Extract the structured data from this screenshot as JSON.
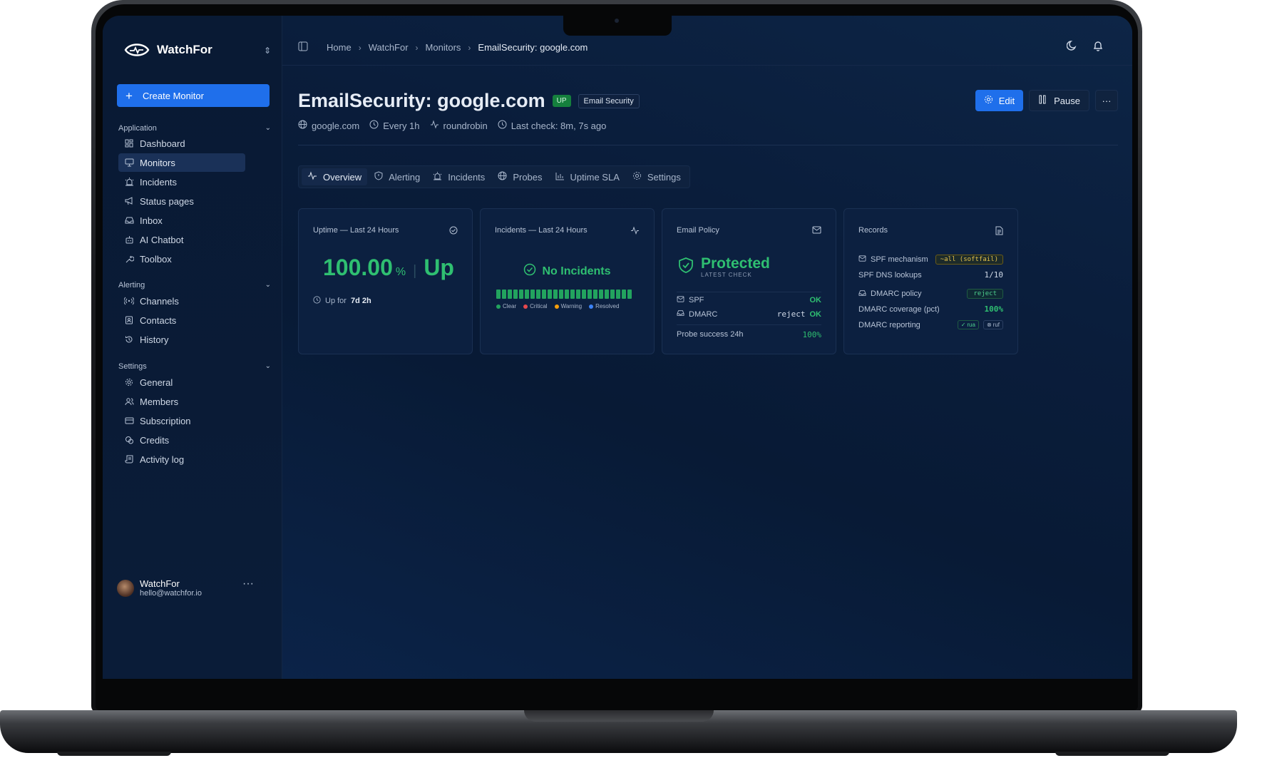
{
  "sidebar": {
    "brand": "WatchFor",
    "create_label": "Create Monitor",
    "sections": {
      "application": "Application",
      "alerting": "Alerting",
      "settings": "Settings"
    },
    "application_items": [
      "Dashboard",
      "Monitors",
      "Incidents",
      "Status pages",
      "Inbox",
      "AI Chatbot",
      "Toolbox"
    ],
    "alerting_items": [
      "Channels",
      "Contacts",
      "History"
    ],
    "settings_items": [
      "General",
      "Members",
      "Subscription",
      "Credits",
      "Activity log"
    ],
    "user": {
      "name": "WatchFor",
      "email": "hello@watchfor.io"
    }
  },
  "breadcrumb": [
    "Home",
    "WatchFor",
    "Monitors",
    "EmailSecurity: google.com"
  ],
  "header": {
    "title": "EmailSecurity: google.com",
    "status_badge": "UP",
    "type_badge": "Email Security",
    "meta": [
      "google.com",
      "Every 1h",
      "roundrobin",
      "Last check: 8m, 7s ago"
    ],
    "edit_label": "Edit",
    "pause_label": "Pause",
    "more_label": "···"
  },
  "tabs": [
    "Overview",
    "Alerting",
    "Incidents",
    "Probes",
    "Uptime SLA",
    "Settings"
  ],
  "cards": {
    "uptime": {
      "title": "Uptime — Last 24 Hours",
      "value": "100.00",
      "unit": "%",
      "state": "Up",
      "up_for_label": "Up for",
      "up_for_value": "7d 2h"
    },
    "incidents": {
      "title": "Incidents — Last 24 Hours",
      "status": "No Incidents",
      "legend": [
        {
          "label": "Clear",
          "color": "#22a35e"
        },
        {
          "label": "Critical",
          "color": "#e5484d"
        },
        {
          "label": "Warning",
          "color": "#f59e0b"
        },
        {
          "label": "Resolved",
          "color": "#3b82f6"
        }
      ]
    },
    "policy": {
      "title": "Email Policy",
      "status": "Protected",
      "sub": "LATEST CHECK",
      "spf_label": "SPF",
      "spf_value": "OK",
      "dmarc_label": "DMARC",
      "dmarc_policy": "reject",
      "dmarc_value": "OK",
      "probe_label": "Probe success 24h",
      "probe_value": "100%"
    },
    "records": {
      "title": "Records",
      "spf_mechanism_label": "SPF mechanism",
      "spf_mechanism_value": "~all (softfail)",
      "spf_lookups_label": "SPF DNS lookups",
      "spf_lookups_value": "1/10",
      "dmarc_policy_label": "DMARC policy",
      "dmarc_policy_value": "reject",
      "dmarc_coverage_label": "DMARC coverage (pct)",
      "dmarc_coverage_value": "100%",
      "dmarc_reporting_label": "DMARC reporting",
      "rua": "rua",
      "ruf": "ruf"
    }
  },
  "colors": {
    "accent": "#1f6feb",
    "success": "#2fbf71",
    "background": "#0a1a33"
  }
}
